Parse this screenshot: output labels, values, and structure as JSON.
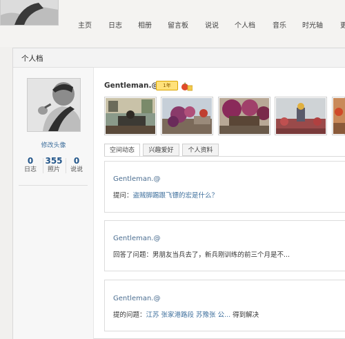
{
  "nav": {
    "items": [
      "主页",
      "日志",
      "相册",
      "留言板",
      "说说",
      "个人档",
      "音乐",
      "时光轴",
      "更"
    ]
  },
  "panel": {
    "title": "个人档"
  },
  "profile": {
    "edit_avatar": "修改头像",
    "stats": [
      {
        "num": "0",
        "label": "日志"
      },
      {
        "num": "355",
        "label": "照片"
      },
      {
        "num": "0",
        "label": "说说"
      }
    ],
    "username": "Gentleman.@",
    "year_badge": "1年"
  },
  "tabs": [
    "空间动态",
    "兴趣爱好",
    "个人资料"
  ],
  "feed": [
    {
      "name": "Gentleman.@",
      "prefix": "提问：",
      "link": "盗贼脚踢跟飞镖的宏是什么？",
      "suffix": ""
    },
    {
      "name": "Gentleman.@",
      "prefix": "回答了问题：",
      "link": "男朋友当兵去了，新兵刚训练的前三个月是不...",
      "suffix": ""
    },
    {
      "name": "Gentleman.@",
      "prefix": "提的问题：",
      "link": "江苏 张家港路段 苏豫张 公...",
      "suffix": " 得到解决"
    }
  ],
  "colors": {
    "link": "#3e6f9c",
    "stat_number": "#23568a",
    "badge": "#ffe17a"
  }
}
